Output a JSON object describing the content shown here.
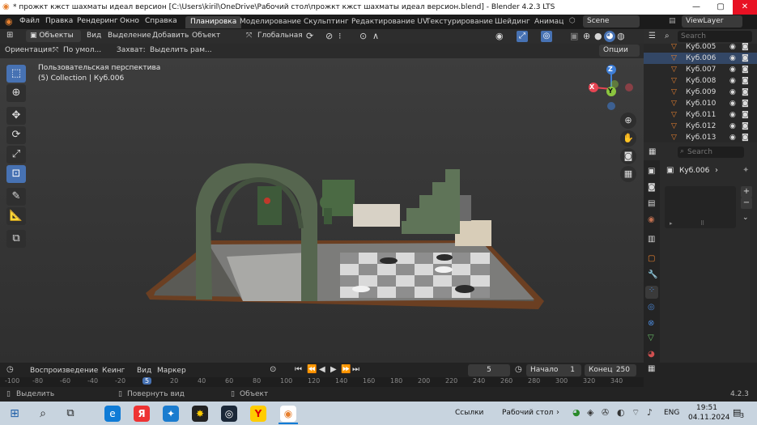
{
  "titlebar": {
    "title": "* прожкт кжст шахматы идеал версион [C:\\Users\\kiril\\OneDrive\\Рабочий стол\\прожкт кжст шахматы идеал версион.blend] - Blender 4.2.3 LTS",
    "minimize": "—",
    "maximize": "▢",
    "close": "✕"
  },
  "menu": {
    "items": [
      "Файл",
      "Правка",
      "Рендеринг",
      "Окно",
      "Справка"
    ],
    "workspaces": [
      "Планировка",
      "Моделирование",
      "Скульптинг",
      "Редактирование UV",
      "Текстурирование",
      "Шейдинг",
      "Анимац"
    ],
    "active_workspace": "Планировка",
    "scene": "Scene",
    "view_layer": "ViewLayer"
  },
  "header": {
    "mode": "Объекты",
    "menus": [
      "Вид",
      "Выделение",
      "Добавить",
      "Объект"
    ],
    "transform": "Глобальная"
  },
  "tool_options": {
    "orientation_label": "Ориентация:",
    "orientation_value": "По умол...",
    "capture_label": "Захват:",
    "capture_value": "Выделить рам...",
    "options": "Опции"
  },
  "viewport": {
    "perspective": "Пользовательская перспектива",
    "collection": "(5) Collection | Куб.006",
    "gizmo": {
      "z": "Z",
      "y": "Y",
      "x": "X"
    }
  },
  "outliner": {
    "search_placeholder": "Search",
    "items": [
      "Куб.005",
      "Куб.006",
      "Куб.007",
      "Куб.008",
      "Куб.009",
      "Куб.010",
      "Куб.011",
      "Куб.012",
      "Куб.013"
    ],
    "selected": "Куб.006"
  },
  "properties": {
    "search_placeholder": "Search",
    "object_name": "Куб.006"
  },
  "timeline": {
    "menus": [
      "Воспроизведение",
      "Кеинг",
      "Вид",
      "Маркер"
    ],
    "current_frame": "5",
    "start_label": "Начало",
    "start": "1",
    "end_label": "Конец",
    "end": "250",
    "ticks": [
      "-100",
      "-80",
      "-60",
      "-40",
      "-20",
      "5",
      "20",
      "40",
      "60",
      "80",
      "100",
      "120",
      "140",
      "160",
      "180",
      "200",
      "220",
      "240",
      "260",
      "280",
      "300",
      "320",
      "340"
    ]
  },
  "statusbar": {
    "select": "Выделить",
    "rotate": "Повернуть вид",
    "object": "Объект",
    "version": "4.2.3"
  },
  "taskbar": {
    "items": [
      "Ссылки",
      "Рабочий стол"
    ],
    "language": "ENG",
    "time": "19:51",
    "date": "04.11.2024",
    "notifications": "3"
  },
  "colors": {
    "accent": "#4772b3",
    "active_orange": "#e7802f",
    "axis_x": "#e64553",
    "axis_y": "#8bc53f",
    "axis_z": "#3f7fd8"
  }
}
